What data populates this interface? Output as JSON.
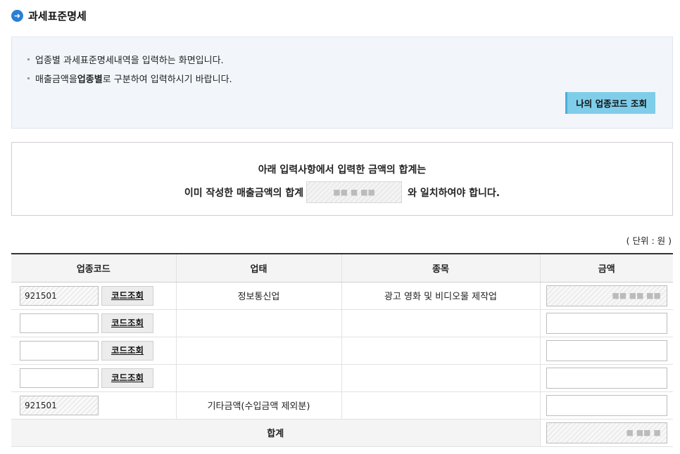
{
  "page": {
    "title": "과세표준명세",
    "title_icon": "arrow-right-circle-icon",
    "accent_color": "#2a7fd4"
  },
  "info": {
    "line1": "업종별 과세표준명세내역을 입력하는 화면입니다.",
    "line2_pre": "매출금액을 ",
    "line2_bold": "업종별",
    "line2_post": "로 구분하여 입력하시기 바랍니다.",
    "my_code_button": "나의 업종코드 조회"
  },
  "notice": {
    "line1": "아래 입력사항에서  입력한 금액의 합계는",
    "line2_pre": "이미 작성한 매출금액의 합계",
    "sum_value": "■■ ■ ■■",
    "line2_post": "와 일치하여야 합니다."
  },
  "unit": "( 단위 : 원 )",
  "table": {
    "headers": [
      "업종코드",
      "업태",
      "종목",
      "금액"
    ],
    "code_button": "코드조회",
    "rows": [
      {
        "code": "921501",
        "business_type": "정보통신업",
        "item": "광고 영화 및 비디오물 제작업",
        "amount": "■■ ■■ ■■"
      },
      {
        "code": "",
        "business_type": "",
        "item": "",
        "amount": ""
      },
      {
        "code": "",
        "business_type": "",
        "item": "",
        "amount": ""
      },
      {
        "code": "",
        "business_type": "",
        "item": "",
        "amount": ""
      }
    ],
    "other_row": {
      "code": "921501",
      "label": "기타금액(수입금액 제외분)",
      "amount": ""
    },
    "total": {
      "label": "합계",
      "amount": "■ ■■ ■"
    }
  }
}
